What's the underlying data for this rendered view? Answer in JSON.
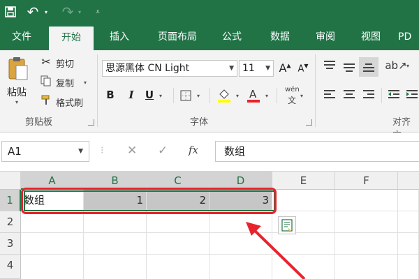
{
  "quick_access": {
    "save_icon": "save-icon",
    "undo_icon": "undo-icon",
    "redo_icon": "redo-icon",
    "customize_icon": "customize-icon"
  },
  "tabs": [
    {
      "label": "文件",
      "active": false
    },
    {
      "label": "开始",
      "active": true
    },
    {
      "label": "插入",
      "active": false
    },
    {
      "label": "页面布局",
      "active": false
    },
    {
      "label": "公式",
      "active": false
    },
    {
      "label": "数据",
      "active": false
    },
    {
      "label": "审阅",
      "active": false
    },
    {
      "label": "视图",
      "active": false
    },
    {
      "label": "PD",
      "active": false
    }
  ],
  "clipboard": {
    "paste": "粘贴",
    "cut": "剪切",
    "copy": "复制",
    "format_painter": "格式刷",
    "group_label": "剪贴板"
  },
  "font": {
    "name": "思源黑体 CN Light",
    "size": "11",
    "bold": "B",
    "italic": "I",
    "underline": "U",
    "phonetic": "wén",
    "group_label": "字体"
  },
  "alignment": {
    "group_label": "对齐方"
  },
  "formula_bar": {
    "name_box": "A1",
    "cancel": "✕",
    "enter": "✓",
    "fx": "fx",
    "content": "数组"
  },
  "grid": {
    "columns": [
      "A",
      "B",
      "C",
      "D",
      "E",
      "F"
    ],
    "rows": [
      "1",
      "2",
      "3",
      "4"
    ],
    "cells": {
      "A1": "数组",
      "B1": "1",
      "C1": "2",
      "D1": "3"
    }
  },
  "colors": {
    "accent": "#217346",
    "highlight": "#e8232d",
    "selection": "#c6c6c6"
  }
}
